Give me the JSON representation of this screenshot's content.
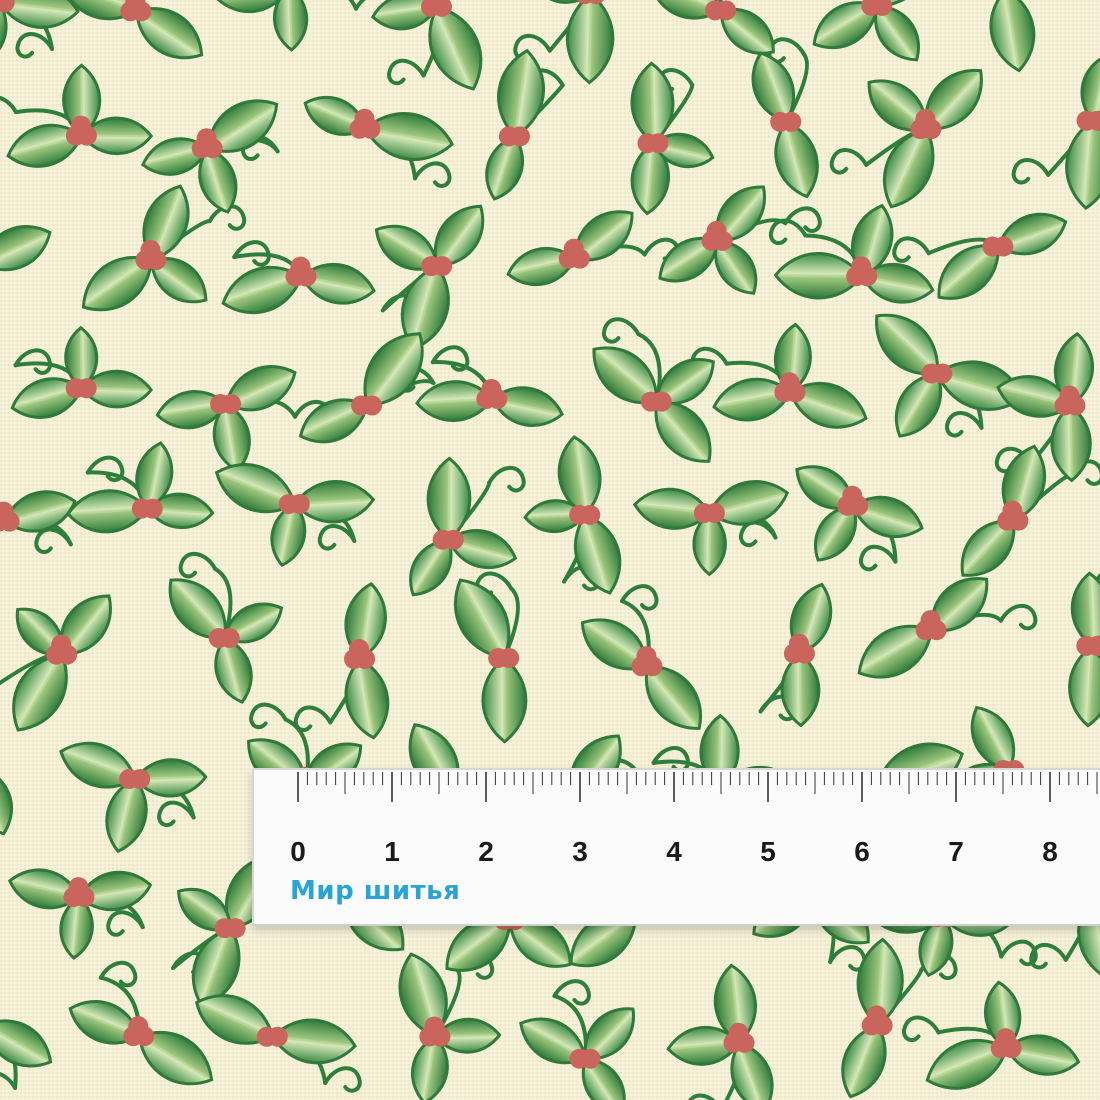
{
  "photo": {
    "subject": "fabric-swatch",
    "colors": {
      "background": "#f4efd6",
      "leaf_dark": "#2f7a3b",
      "leaf_light": "#bcd79a",
      "vine": "#2e7f3c",
      "berry": "#c9655c",
      "ruler": "#fbfbfb",
      "brand": "#2aa3d8"
    }
  },
  "ruler": {
    "unit_labels": [
      "0",
      "1",
      "2",
      "3",
      "4",
      "5",
      "6",
      "7",
      "8"
    ],
    "brand_text": "Мир шитья"
  }
}
